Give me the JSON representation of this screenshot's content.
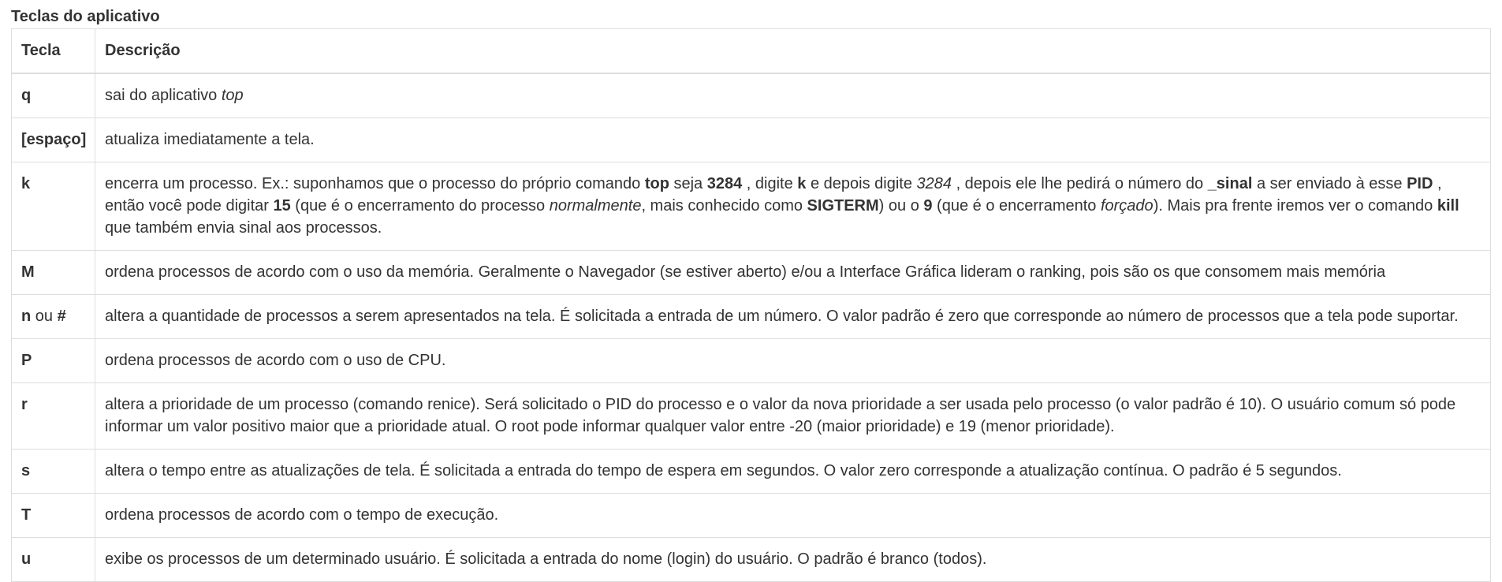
{
  "caption": "Teclas do aplicativo",
  "headers": {
    "key": "Tecla",
    "description": "Descrição"
  },
  "rows": [
    {
      "key": [
        {
          "t": "q",
          "s": "b"
        }
      ],
      "desc": [
        {
          "t": "sai do aplicativo "
        },
        {
          "t": "top",
          "s": "i"
        }
      ]
    },
    {
      "key": [
        {
          "t": "[espaço]",
          "s": "b"
        }
      ],
      "desc": [
        {
          "t": "atualiza imediatamente a tela."
        }
      ]
    },
    {
      "key": [
        {
          "t": "k",
          "s": "b"
        }
      ],
      "desc": [
        {
          "t": "encerra um processo. Ex.: suponhamos que o processo do próprio comando "
        },
        {
          "t": "top",
          "s": "b"
        },
        {
          "t": " seja "
        },
        {
          "t": "3284",
          "s": "b"
        },
        {
          "t": " , digite "
        },
        {
          "t": "k",
          "s": "b"
        },
        {
          "t": " e depois digite "
        },
        {
          "t": "3284",
          "s": "i"
        },
        {
          "t": " , depois ele lhe pedirá o número do "
        },
        {
          "t": "_sinal",
          "s": "b"
        },
        {
          "t": " a ser enviado à esse "
        },
        {
          "t": "PID",
          "s": "b"
        },
        {
          "t": " , então você pode digitar "
        },
        {
          "t": "15",
          "s": "b"
        },
        {
          "t": " (que é o encerramento do processo "
        },
        {
          "t": "normalmente",
          "s": "i"
        },
        {
          "t": ", mais conhecido como "
        },
        {
          "t": "SIGTERM",
          "s": "b"
        },
        {
          "t": ") ou o "
        },
        {
          "t": "9",
          "s": "b"
        },
        {
          "t": " (que é o encerramento "
        },
        {
          "t": "forçado",
          "s": "i"
        },
        {
          "t": "). Mais pra frente iremos ver o comando "
        },
        {
          "t": "kill",
          "s": "b"
        },
        {
          "t": " que também envia sinal aos processos."
        }
      ]
    },
    {
      "key": [
        {
          "t": "M",
          "s": "b"
        }
      ],
      "desc": [
        {
          "t": "ordena processos de acordo com o uso da memória. Geralmente o Navegador (se estiver aberto) e/ou a Interface Gráfica lideram o ranking, pois são os que consomem mais memória"
        }
      ]
    },
    {
      "key": [
        {
          "t": "n",
          "s": "b"
        },
        {
          "t": " ou "
        },
        {
          "t": "#",
          "s": "b"
        }
      ],
      "desc": [
        {
          "t": "altera a quantidade de processos a serem apresentados na tela. É solicitada a entrada de um número. O valor padrão é zero que corresponde ao número de processos que a tela pode suportar."
        }
      ]
    },
    {
      "key": [
        {
          "t": "P",
          "s": "b"
        }
      ],
      "desc": [
        {
          "t": "ordena processos de acordo com o uso de CPU."
        }
      ]
    },
    {
      "key": [
        {
          "t": "r",
          "s": "b"
        }
      ],
      "desc": [
        {
          "t": "altera a prioridade de um processo (comando renice). Será solicitado o PID do processo e o valor da nova prioridade a ser usada pelo processo (o valor padrão é 10). O usuário comum só pode informar um valor positivo maior que a prioridade atual. O root pode informar qualquer valor entre -20 (maior prioridade) e 19 (menor prioridade)."
        }
      ]
    },
    {
      "key": [
        {
          "t": "s",
          "s": "b"
        }
      ],
      "desc": [
        {
          "t": "altera o tempo entre as atualizações de tela. É solicitada a entrada do tempo de espera em segundos. O valor zero corresponde a atualização contínua. O padrão é 5 segundos."
        }
      ]
    },
    {
      "key": [
        {
          "t": "T",
          "s": "b"
        }
      ],
      "desc": [
        {
          "t": "ordena processos de acordo com o tempo de execução."
        }
      ]
    },
    {
      "key": [
        {
          "t": "u",
          "s": "b"
        }
      ],
      "desc": [
        {
          "t": "exibe os processos de um determinado usuário. É solicitada a entrada do nome (login) do usuário. O padrão é branco (todos)."
        }
      ]
    }
  ]
}
